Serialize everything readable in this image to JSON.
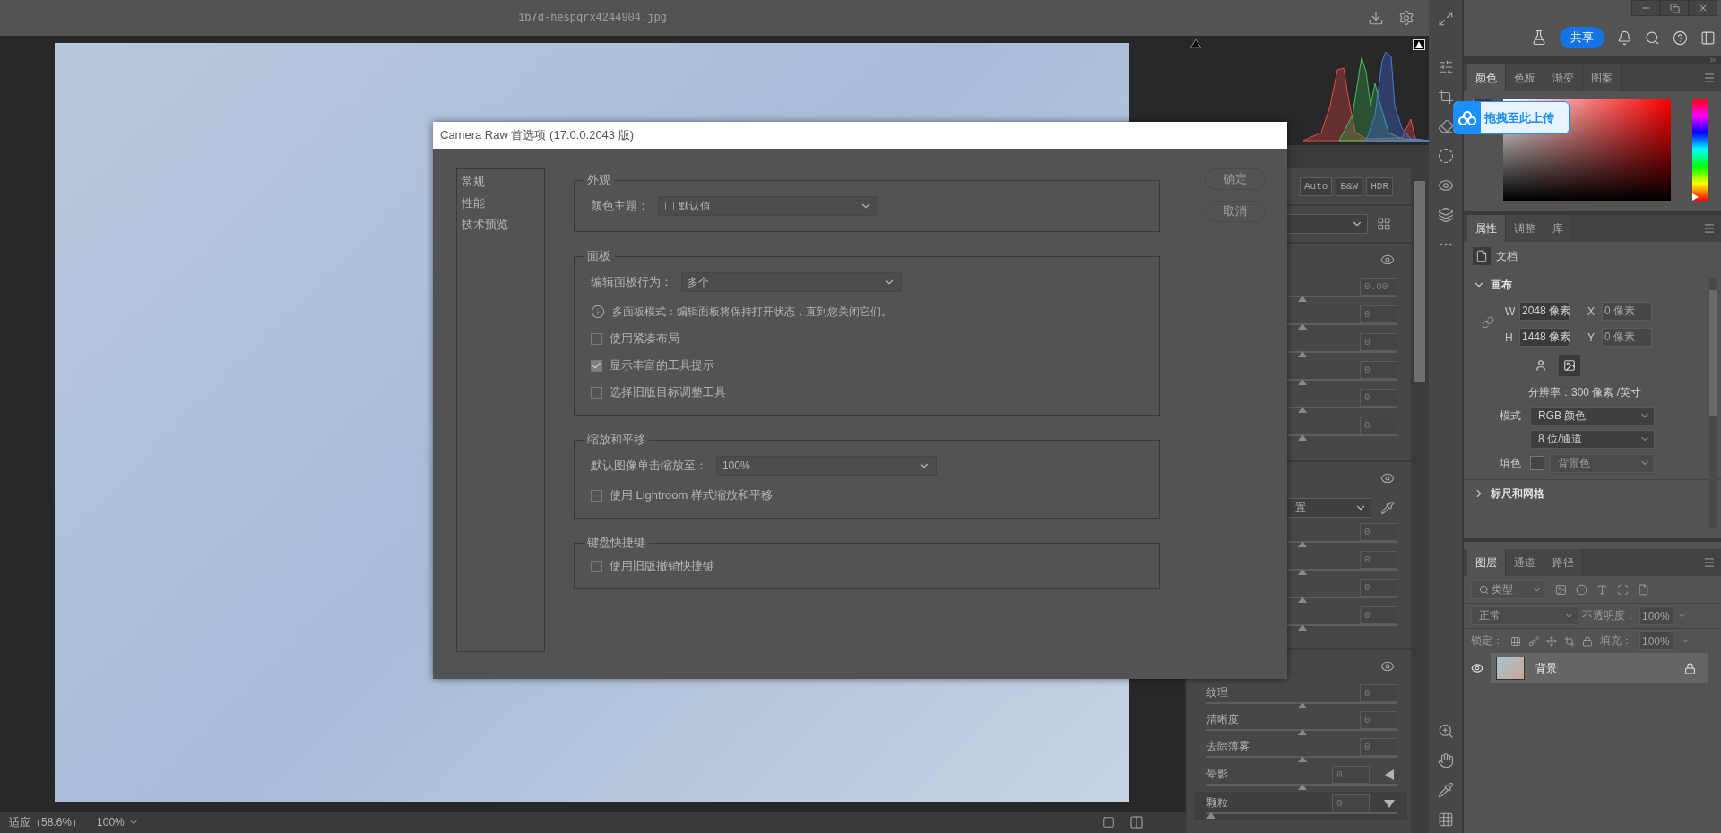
{
  "document": {
    "filename": "1b7d-hespqrx4244904.jpg"
  },
  "status_bar": {
    "zoom_fit": "适应（58.6%）",
    "zoom_select": "100%"
  },
  "camera_raw": {
    "profile_buttons": [
      "Auto",
      "B&W",
      "HDR"
    ],
    "basic_sliders": [
      {
        "value": "0.00",
        "level": 0.5
      },
      {
        "value": "0",
        "level": 0.5
      },
      {
        "value": "0",
        "level": 0.5
      },
      {
        "value": "0",
        "level": 0.5
      },
      {
        "value": "0",
        "level": 0.5
      },
      {
        "value": "0",
        "level": 0.5
      }
    ],
    "color_section": {
      "dropdown": "置",
      "sliders": [
        {
          "value": "0",
          "level": 0.5
        },
        {
          "value": "0",
          "level": 0.5
        },
        {
          "value": "0",
          "level": 0.5
        },
        {
          "value": "0",
          "level": 0.5
        }
      ]
    },
    "effects": [
      {
        "kind": "slider",
        "label": "纹理",
        "value": "0",
        "level": 0.5
      },
      {
        "kind": "slider",
        "label": "清晰度",
        "value": "0",
        "level": 0.5
      },
      {
        "kind": "slider",
        "label": "去除薄雾",
        "value": "0",
        "level": 0.5
      },
      {
        "kind": "group",
        "label": "晕影",
        "value": "0",
        "level": 0.5,
        "expanded": false
      },
      {
        "kind": "group",
        "label": "颗粒",
        "value": "0",
        "level": 0,
        "expanded": true
      }
    ]
  },
  "dialog": {
    "title": "Camera Raw 首选项 (17.0.0.2043 版)",
    "nav": [
      {
        "label": "常规",
        "selected": false
      },
      {
        "label": "性能",
        "selected": false
      },
      {
        "label": "技术预览",
        "selected": false
      }
    ],
    "buttons": [
      "确定",
      "取消"
    ],
    "groups": [
      {
        "title": "外观",
        "items": [
          {
            "kind": "select",
            "label": "颜色主题：",
            "value": "默认值",
            "swatch": true
          }
        ]
      },
      {
        "title": "面板",
        "items": [
          {
            "kind": "select",
            "label": "编辑面板行为：",
            "value": "多个"
          },
          {
            "kind": "info",
            "text": "多面板模式：编辑面板将保持打开状态，直到您关闭它们。"
          },
          {
            "kind": "checkbox",
            "label": "使用紧凑布局",
            "checked": false
          },
          {
            "kind": "checkbox",
            "label": "显示丰富的工具提示",
            "checked": true
          },
          {
            "kind": "checkbox",
            "label": "选择旧版目标调整工具",
            "checked": false
          }
        ]
      },
      {
        "title": "缩放和平移",
        "items": [
          {
            "kind": "select",
            "label": "默认图像单击缩放至：",
            "value": "100%"
          },
          {
            "kind": "checkbox",
            "label": "使用 Lightroom 样式缩放和平移",
            "checked": false
          }
        ]
      },
      {
        "title": "键盘快捷键",
        "items": [
          {
            "kind": "checkbox",
            "label": "使用旧版撤销快捷键",
            "checked": false
          }
        ]
      }
    ]
  },
  "photoshop": {
    "share_button": "共享",
    "color_panel": {
      "tabs": [
        {
          "label": "颜色",
          "selected": true
        },
        {
          "label": "色板",
          "selected": false
        },
        {
          "label": "渐变",
          "selected": false
        },
        {
          "label": "图案",
          "selected": false
        }
      ],
      "hue_slider": {
        "level": 0
      }
    },
    "properties_panel": {
      "tabs": [
        {
          "label": "属性",
          "selected": true
        },
        {
          "label": "调整",
          "selected": false
        },
        {
          "label": "库",
          "selected": false
        }
      ],
      "document_label": "文档",
      "canvas": {
        "title": "画布",
        "expanded": true,
        "width_label": "W",
        "width": "2048 像素",
        "x_label": "X",
        "x": "0 像素",
        "height_label": "H",
        "height": "1448 像素",
        "y_label": "Y",
        "y": "0 像素",
        "orientation": [
          {
            "kind": "portrait",
            "selected": false
          },
          {
            "kind": "landscape",
            "selected": true
          }
        ],
        "resolution": "分辨率：300 像素 /英寸",
        "mode_label": "模式",
        "mode": "RGB 颜色",
        "depth": "8 位/通道",
        "fill_label": "填色",
        "fill": "背景色"
      },
      "rulers": {
        "title": "标尺和网格",
        "expanded": false
      }
    },
    "layers_panel": {
      "tabs": [
        {
          "label": "图层",
          "selected": true
        },
        {
          "label": "通道",
          "selected": false
        },
        {
          "label": "路径",
          "selected": false
        }
      ],
      "filter": "类型",
      "blend_mode": "正常",
      "opacity_label": "不透明度：",
      "opacity": "100%",
      "lock_label": "锁定：",
      "fill_label": "填充：",
      "fill": "100%",
      "layers": [
        {
          "name": "背景",
          "visible": true,
          "selected": true,
          "locked": true
        }
      ]
    }
  },
  "upload_badge": {
    "label": "拖拽至此上传"
  }
}
